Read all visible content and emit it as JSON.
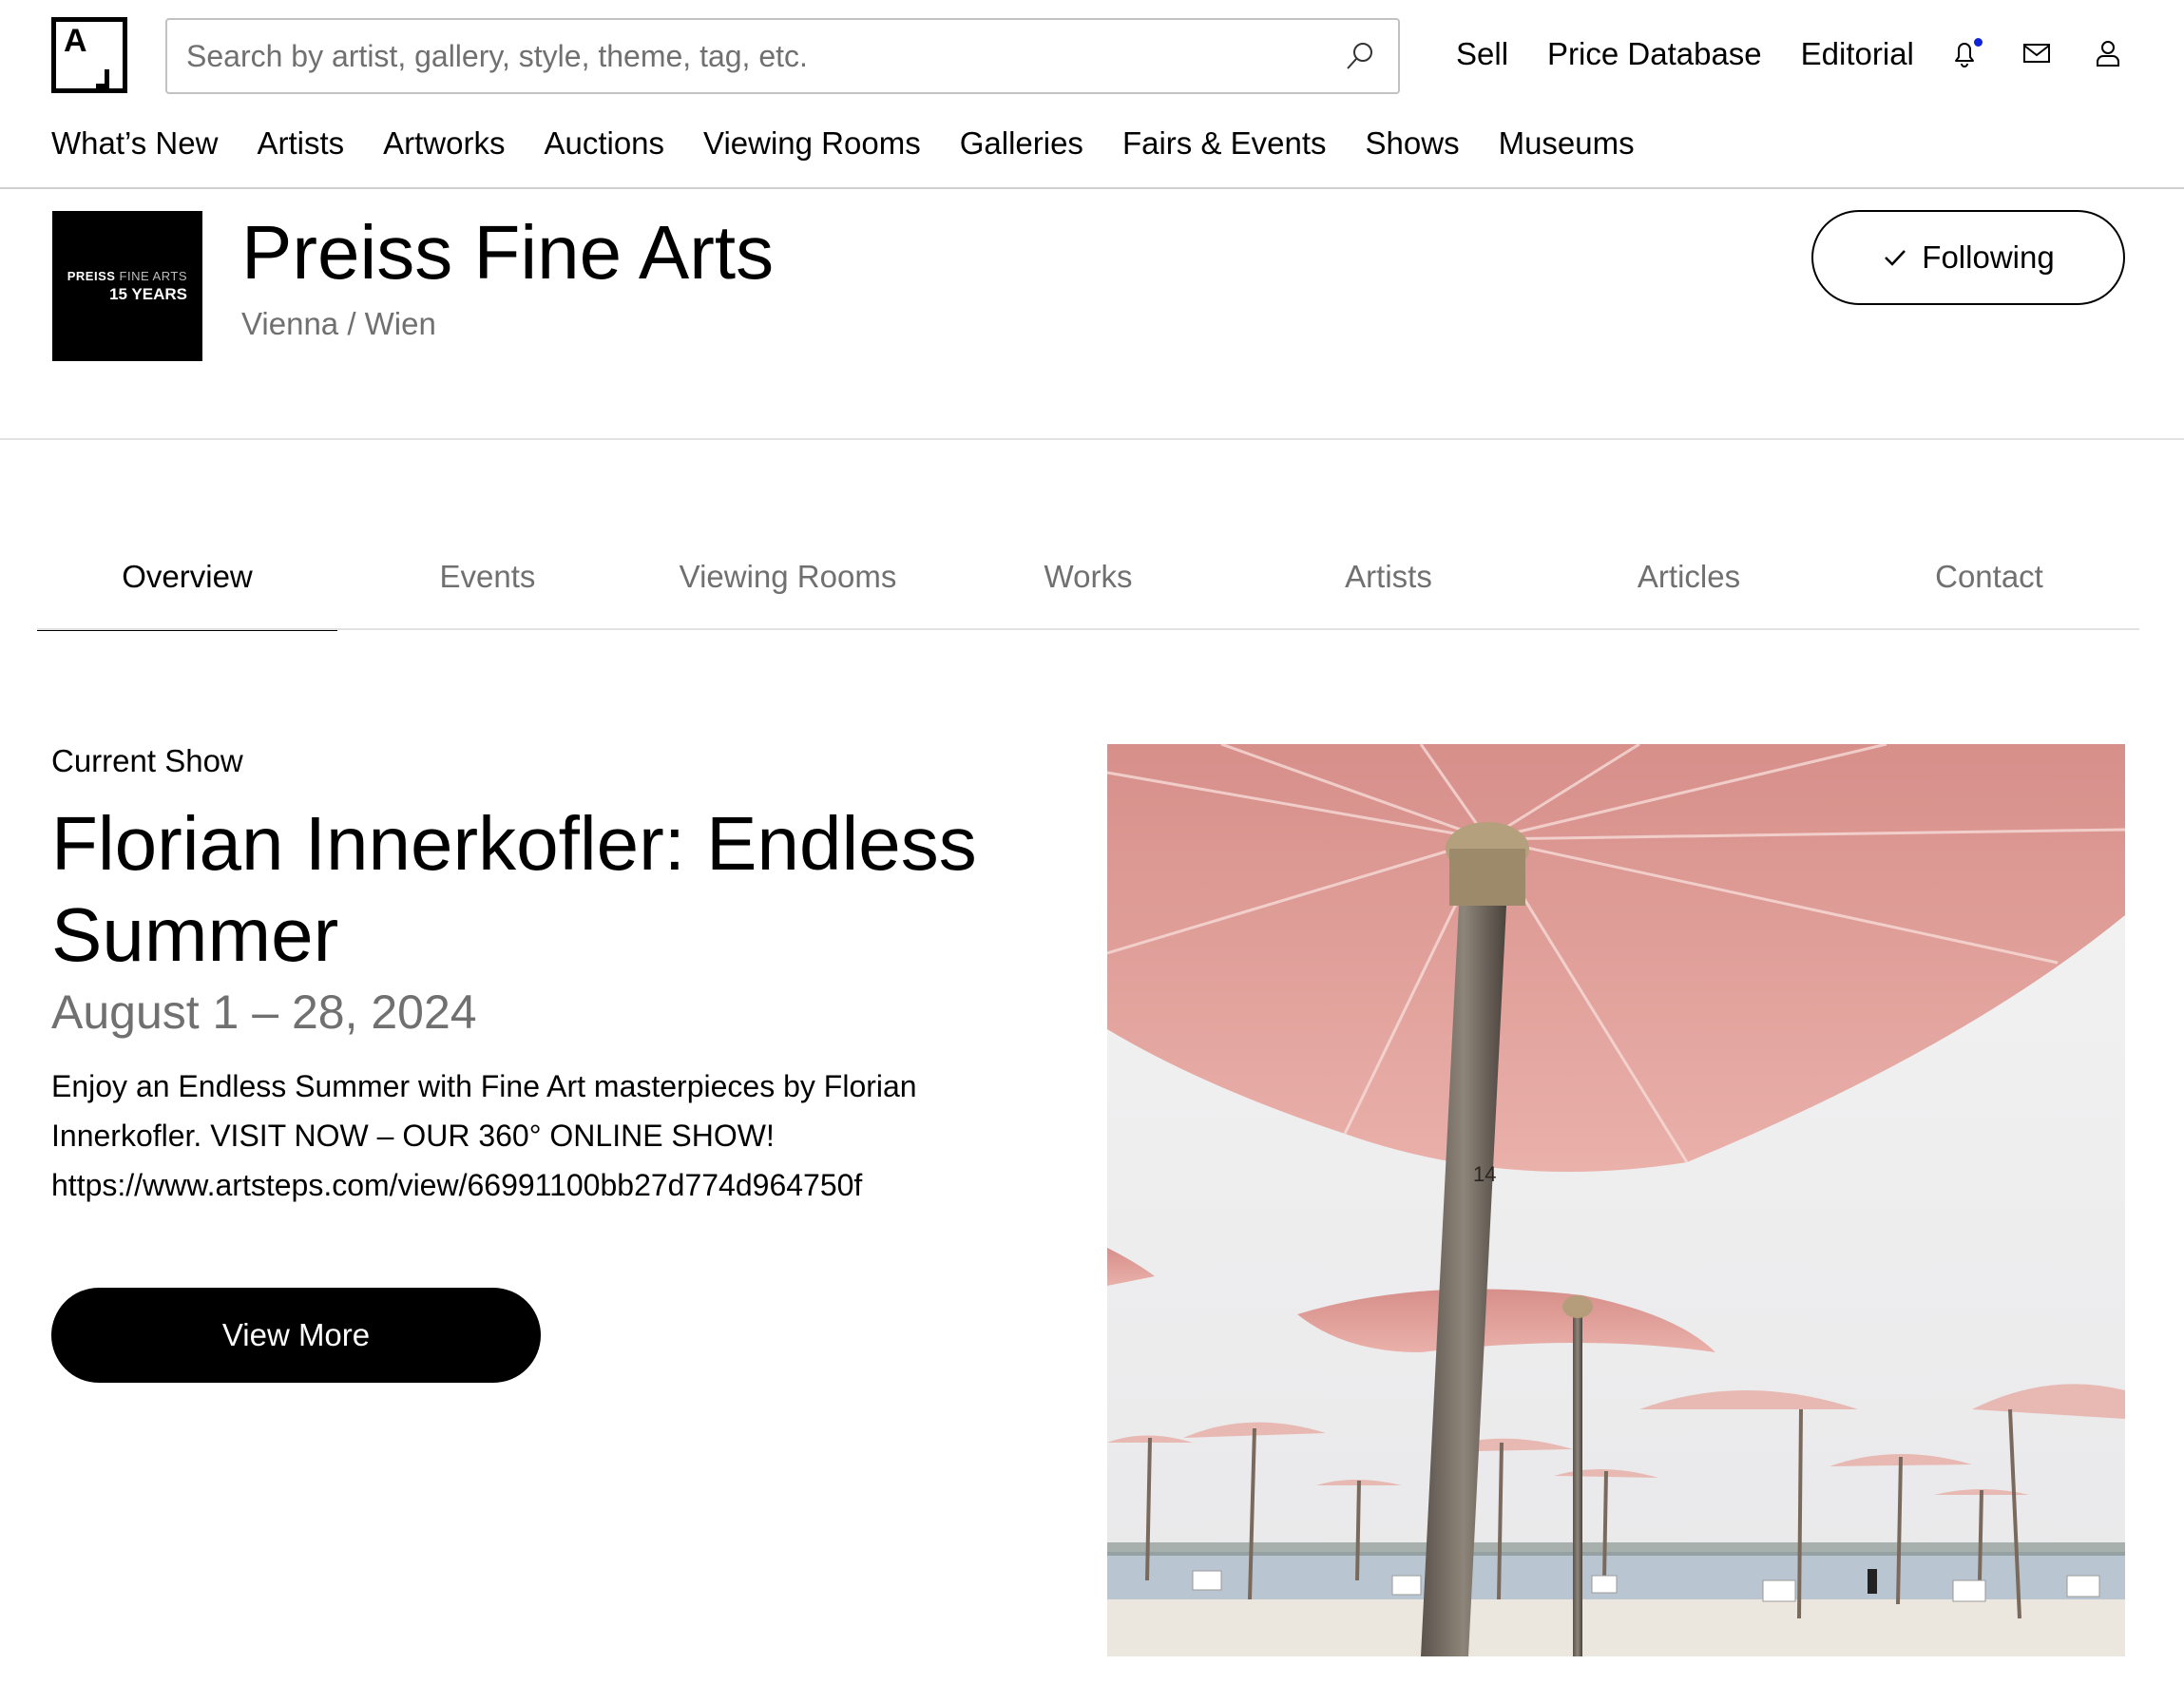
{
  "header": {
    "logo_letter": "A",
    "search_placeholder": "Search by artist, gallery, style, theme, tag, etc.",
    "top_links": [
      "Sell",
      "Price Database",
      "Editorial"
    ],
    "icons": [
      "bell-icon",
      "mail-icon",
      "user-icon"
    ],
    "main_nav": [
      "What’s New",
      "Artists",
      "Artworks",
      "Auctions",
      "Viewing Rooms",
      "Galleries",
      "Fairs & Events",
      "Shows",
      "Museums"
    ]
  },
  "gallery": {
    "logo_line1_bold": "PREISS",
    "logo_line1_light": " FINE ARTS",
    "logo_line2": "15 YEARS",
    "name": "Preiss Fine Arts",
    "location": "Vienna / Wien",
    "follow_label": "Following"
  },
  "tabs": {
    "items": [
      "Overview",
      "Events",
      "Viewing Rooms",
      "Works",
      "Artists",
      "Articles",
      "Contact"
    ],
    "active": "Overview"
  },
  "current_show": {
    "label": "Current Show",
    "title": "Florian Innerkofler: Endless Summer",
    "dates": "August 1 – 28, 2024",
    "description": "Enjoy an Endless Summer with Fine Art masterpieces by Florian Innerkofler. VISIT NOW – OUR 360° ONLINE SHOW! https://www.artsteps.com/view/66991100bb27d774d964750f",
    "button_label": "View More",
    "image_number_mark": "14"
  },
  "colors": {
    "accent_dot": "#1023d7",
    "muted_text": "#707070",
    "umbrella_pink": "#e8a8a2"
  }
}
